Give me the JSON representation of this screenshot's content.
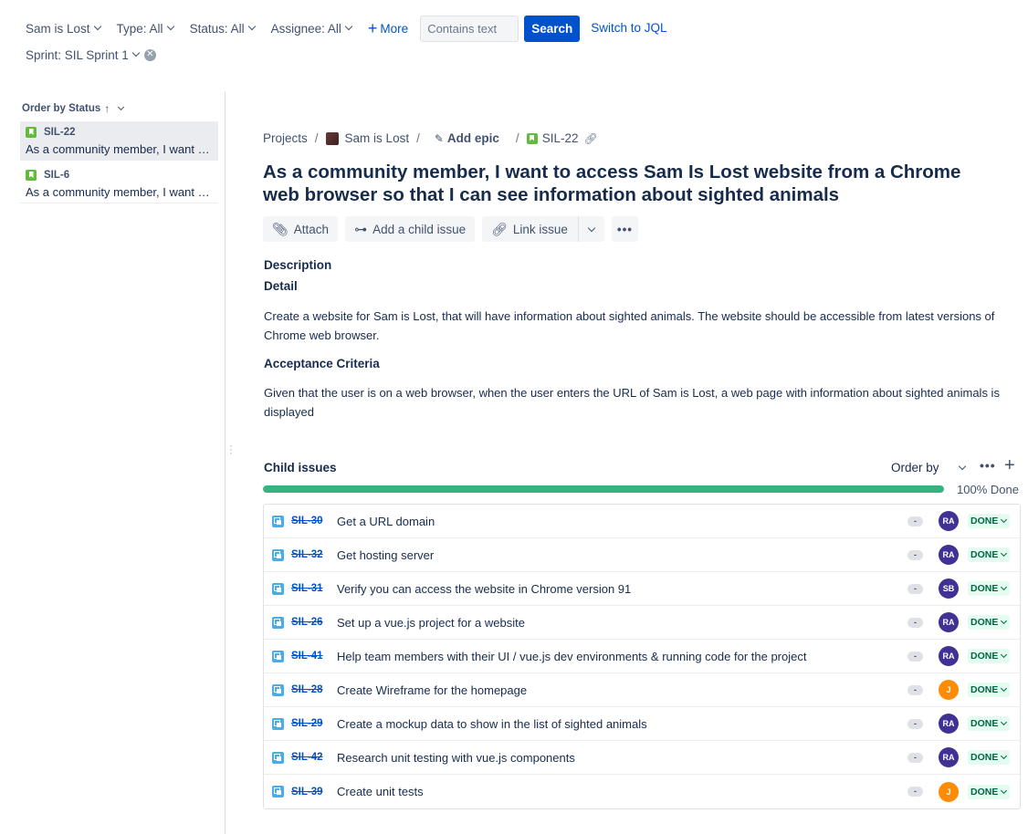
{
  "filters": {
    "project": "Sam is Lost",
    "type": "Type: All",
    "status": "Status: All",
    "assignee": "Assignee: All",
    "more": "More",
    "search_placeholder": "Contains text",
    "search_button": "Search",
    "switch_jql": "Switch to JQL",
    "sprint": "Sprint: SIL Sprint 1"
  },
  "left_panel": {
    "order_by": "Order by Status",
    "items": [
      {
        "key": "SIL-22",
        "summary": "As a community member, I want to access Sam Is Lost website from a Chrome web browser so that I can see information about sighted animals"
      },
      {
        "key": "SIL-6",
        "summary": "As a community member, I want to report a sighted animal"
      }
    ]
  },
  "breadcrumb": {
    "projects": "Projects",
    "project": "Sam is Lost",
    "add_epic": "Add epic",
    "issue_key": "SIL-22"
  },
  "issue": {
    "title": "As a community member, I want to access Sam Is Lost website from a Chrome web browser so that I can see information about sighted animals",
    "actions": {
      "attach": "Attach",
      "add_child": "Add a child issue",
      "link_issue": "Link issue"
    },
    "description_label": "Description",
    "detail_heading": "Detail",
    "detail_text": "Create a website for Sam is Lost, that will have information about sighted animals. The website should be accessible from latest versions of Chrome web browser.",
    "ac_heading": "Acceptance Criteria",
    "ac_text": "Given that the user is on a web browser, when the user enters the URL of Sam is Lost, a web page with information about sighted animals is displayed"
  },
  "child_issues": {
    "heading": "Child issues",
    "order_by": "Order by",
    "progress_percent": 100,
    "progress_label": "100% Done",
    "colors": {
      "ra": "#403294",
      "sb": "#403294",
      "j": "#ff8b00",
      "progress": "#36b37e"
    },
    "rows": [
      {
        "key": "SIL-30",
        "summary": "Get a URL domain",
        "priority": "-",
        "assignee": "RA",
        "status": "DONE"
      },
      {
        "key": "SIL-32",
        "summary": "Get hosting server",
        "priority": "-",
        "assignee": "RA",
        "status": "DONE"
      },
      {
        "key": "SIL-31",
        "summary": "Verify you can access the website in Chrome version 91",
        "priority": "-",
        "assignee": "SB",
        "status": "DONE"
      },
      {
        "key": "SIL-26",
        "summary": "Set up a vue.js project for a website",
        "priority": "-",
        "assignee": "RA",
        "status": "DONE"
      },
      {
        "key": "SIL-41",
        "summary": "Help team members with their UI / vue.js dev environments & running code for the project",
        "priority": "-",
        "assignee": "RA",
        "status": "DONE"
      },
      {
        "key": "SIL-28",
        "summary": "Create Wireframe for the homepage",
        "priority": "-",
        "assignee": "J",
        "status": "DONE"
      },
      {
        "key": "SIL-29",
        "summary": "Create a mockup data to show in the list of sighted animals",
        "priority": "-",
        "assignee": "RA",
        "status": "DONE"
      },
      {
        "key": "SIL-42",
        "summary": "Research unit testing with vue.js components",
        "priority": "-",
        "assignee": "RA",
        "status": "DONE"
      },
      {
        "key": "SIL-39",
        "summary": "Create unit tests",
        "priority": "-",
        "assignee": "J",
        "status": "DONE"
      }
    ]
  }
}
